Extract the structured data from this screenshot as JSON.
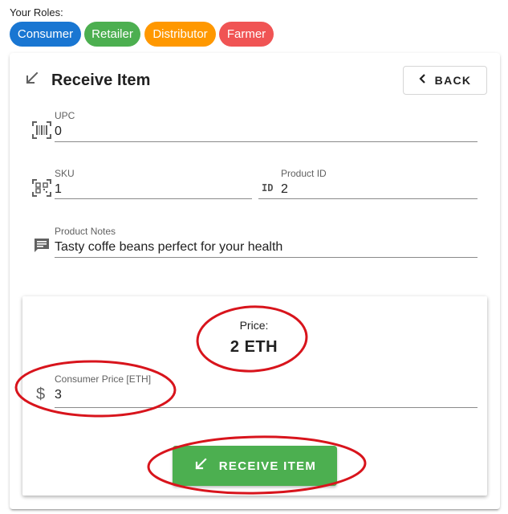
{
  "roles": {
    "label": "Your Roles:",
    "chips": [
      {
        "label": "Consumer",
        "color": "#1976d2"
      },
      {
        "label": "Retailer",
        "color": "#4caf50"
      },
      {
        "label": "Distributor",
        "color": "#ff9800"
      },
      {
        "label": "Farmer",
        "color": "#f05454"
      }
    ]
  },
  "header": {
    "title": "Receive Item",
    "icon": "arrow-bottom-left-icon",
    "back_label": "BACK"
  },
  "form": {
    "upc": {
      "label": "UPC",
      "value": "0",
      "icon": "barcode-icon"
    },
    "sku": {
      "label": "SKU",
      "value": "1",
      "icon": "qrcode-icon"
    },
    "product_id": {
      "label": "Product ID",
      "value": "2",
      "icon": "id-icon",
      "icon_text": "ID"
    },
    "notes": {
      "label": "Product Notes",
      "value": "Tasty coffe beans perfect for your health",
      "icon": "message-icon"
    }
  },
  "price": {
    "label": "Price:",
    "value": "2 ETH"
  },
  "consumer_price": {
    "label": "Consumer Price [ETH]",
    "value": "3",
    "icon": "dollar-icon",
    "icon_text": "$"
  },
  "receive_button": {
    "label": "RECEIVE ITEM",
    "color": "#4caf50"
  },
  "annotation_color": "#d8141c"
}
